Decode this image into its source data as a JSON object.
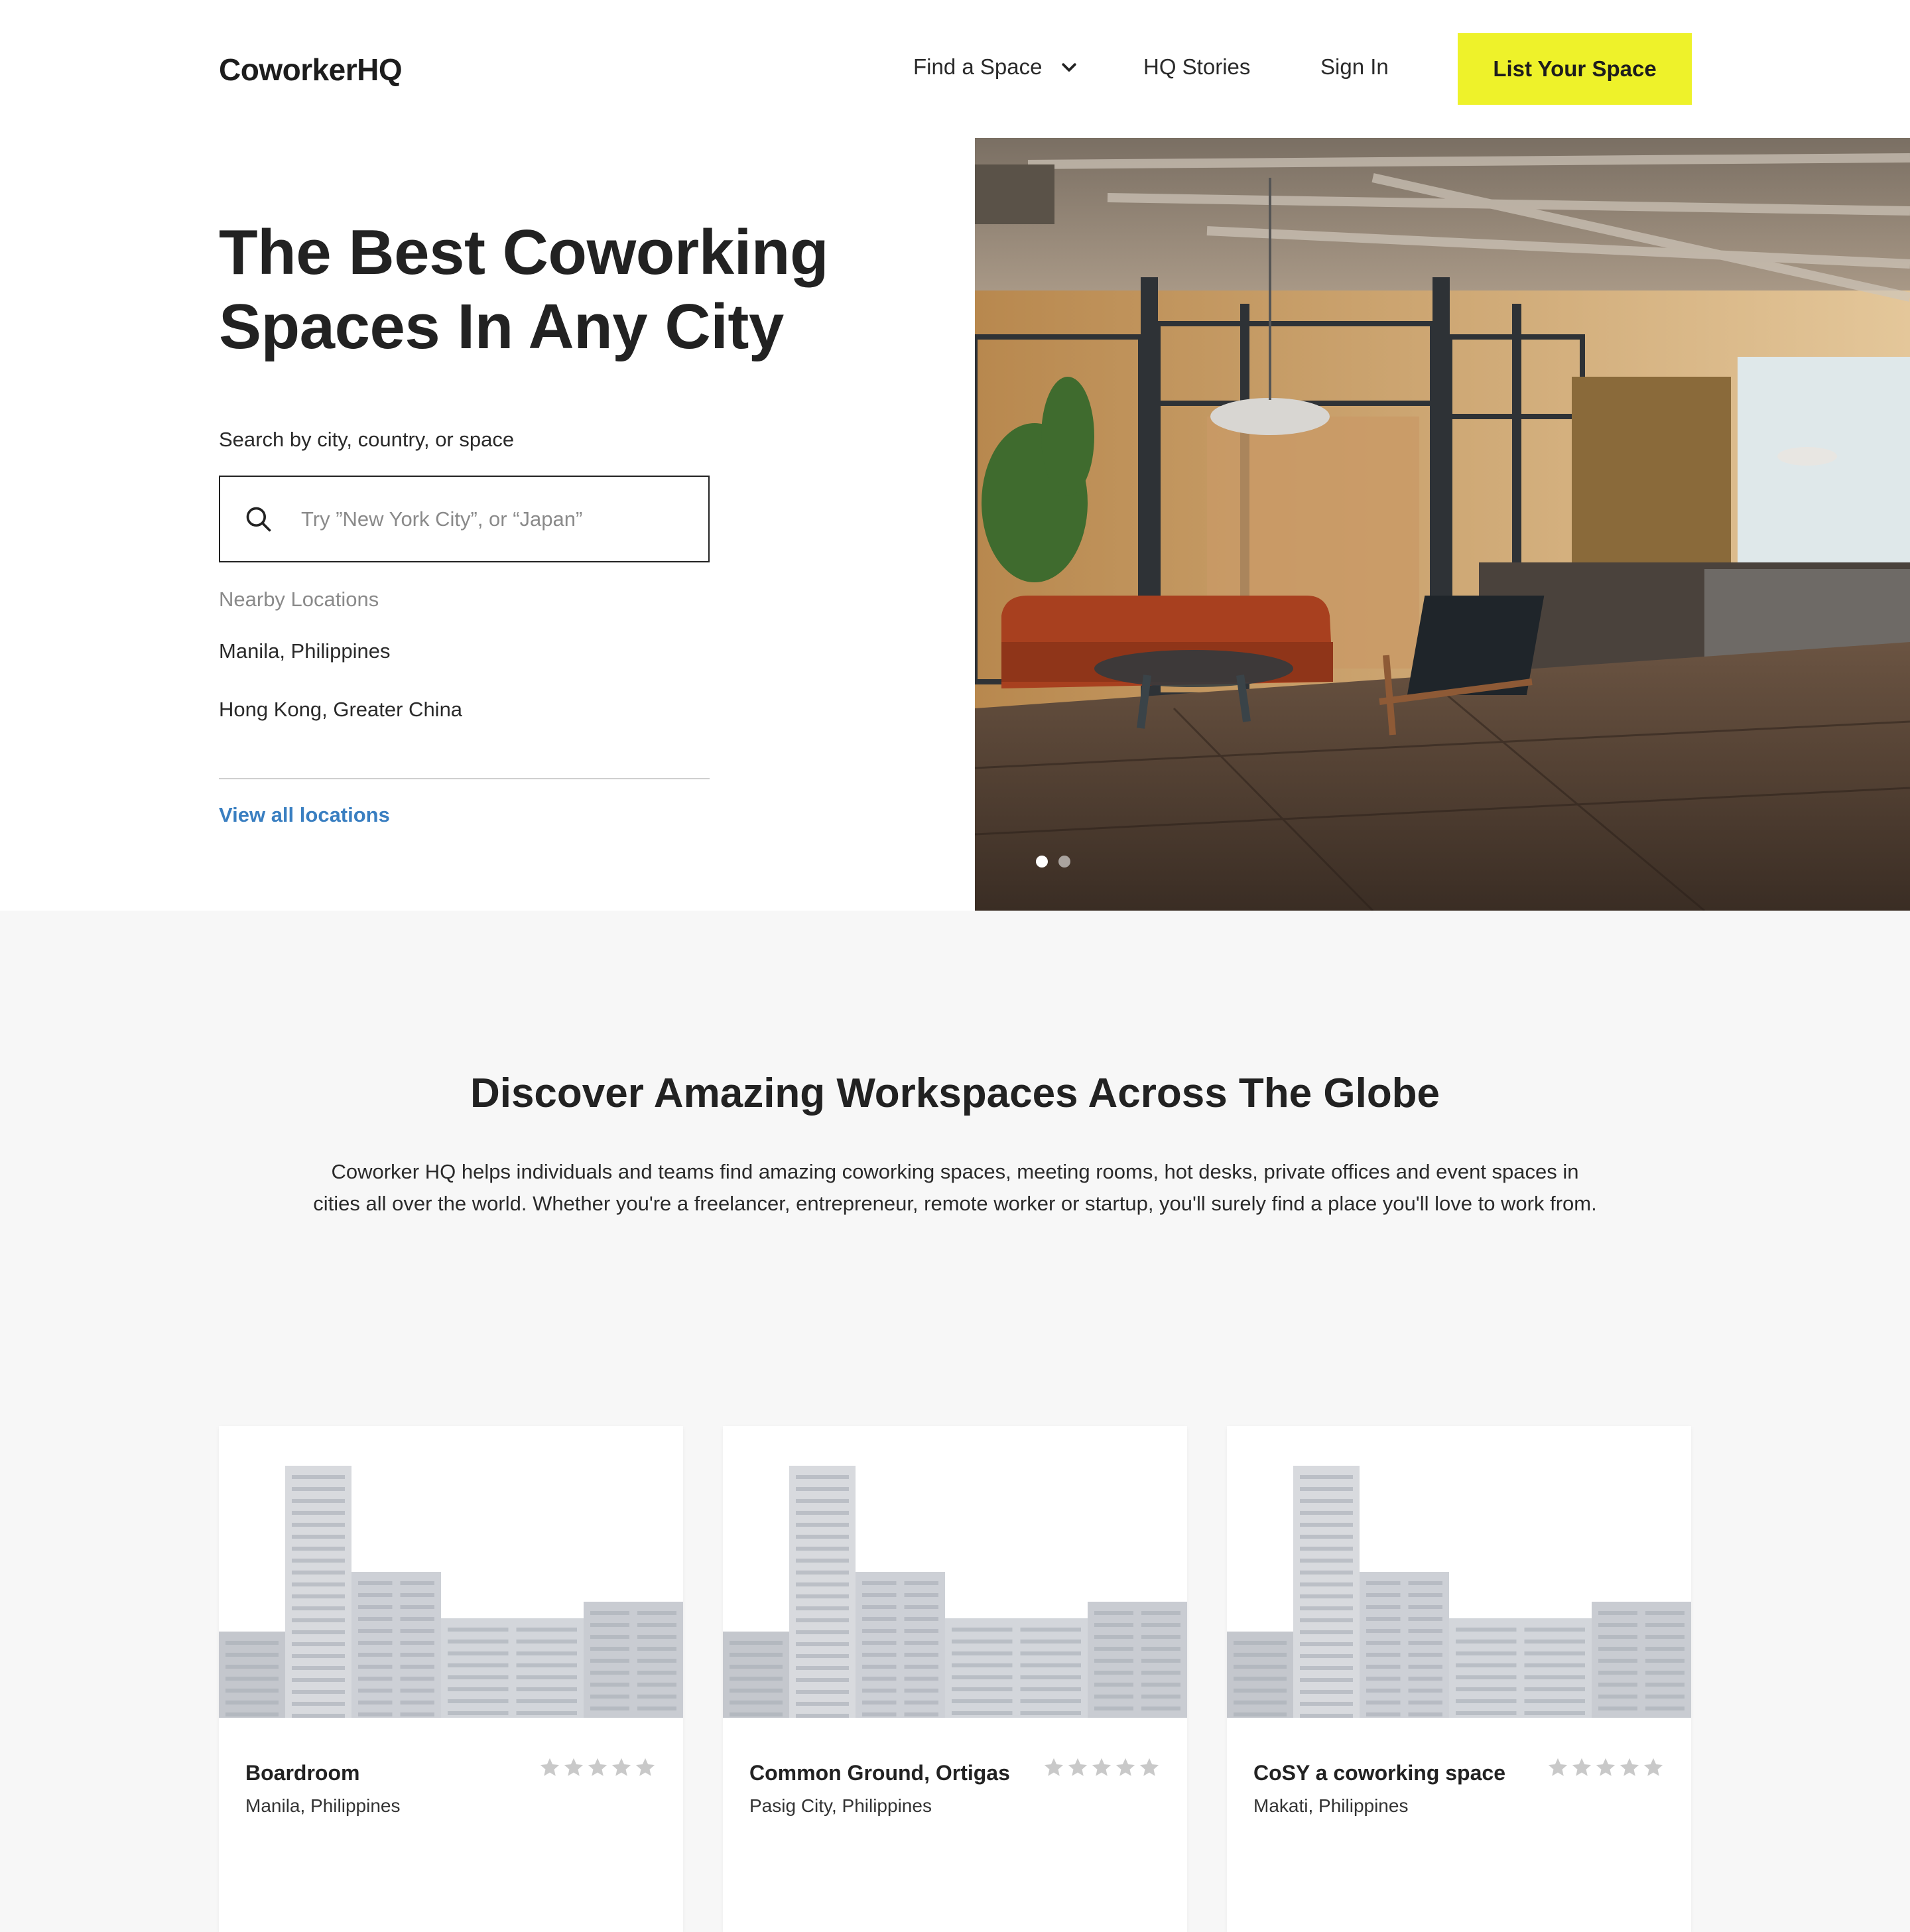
{
  "header": {
    "logo": "CoworkerHQ",
    "nav": {
      "find_space": "Find a Space",
      "stories": "HQ Stories",
      "sign_in": "Sign In"
    },
    "cta": "List Your Space",
    "cta_color": "#eef22a"
  },
  "hero": {
    "title": "The Best Coworking Spaces In Any City",
    "search_label": "Search by city, country, or space",
    "search_placeholder": "Try ”New York City”, or “Japan”",
    "search_value": "",
    "nearby_label": "Nearby Locations",
    "locations": [
      "Manila, Philippines",
      "Hong Kong, Greater China"
    ],
    "view_all": "View all locations",
    "link_color": "#3a7fc1",
    "carousel_slides": 2,
    "carousel_active": 1
  },
  "discover": {
    "title": "Discover Amazing Workspaces Across The Globe",
    "text": "Coworker HQ helps individuals and teams find amazing coworking spaces, meeting rooms, hot desks, private offices and event spaces in cities all over the world. Whether you're a freelancer, entrepreneur, remote worker or startup, you'll surely find a place you'll love to work from."
  },
  "cards": [
    {
      "name": "Boardroom",
      "city": "Manila, Philippines",
      "rating": 0,
      "max_rating": 5
    },
    {
      "name": "Common Ground, Ortigas",
      "city": "Pasig City, Philippines",
      "rating": 0,
      "max_rating": 5
    },
    {
      "name": "CoSY a coworking space",
      "city": "Makati, Philippines",
      "rating": 0,
      "max_rating": 5
    }
  ]
}
